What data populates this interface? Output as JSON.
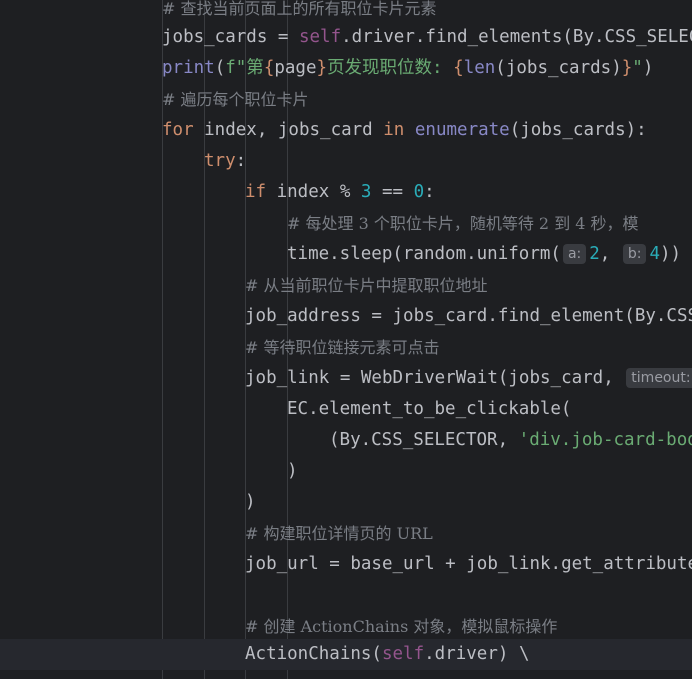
{
  "colors": {
    "background": "#1e1f22",
    "keyword": "#cf8e6d",
    "self": "#94558d",
    "builtin": "#8888c6",
    "number": "#2aacb8",
    "string": "#6aab73",
    "comment": "#7a7e85",
    "text": "#bcbec4",
    "hint_bg": "#393b40"
  },
  "code": {
    "l1_comment": "# 查找当前页面上的所有职位卡片元素",
    "l2_a": "jobs_cards = ",
    "l2_self": "self",
    "l2_b": ".driver.find_elements(By.CSS_SELEC",
    "l3_print": "print",
    "l3_paren": "(",
    "l3_f": "f\"第",
    "l3_brace1": "{",
    "l3_page": "page",
    "l3_brace2": "}",
    "l3_mid": "页发现职位数: ",
    "l3_brace3": "{",
    "l3_len": "len",
    "l3_args": "(jobs_cards)",
    "l3_brace4": "}",
    "l3_end_str": "\"",
    "l3_close": ")",
    "l4_comment": "# 遍历每个职位卡片",
    "l5_for": "for",
    "l5_a": " index, jobs_card ",
    "l5_in": "in",
    "l5_sp": " ",
    "l5_enum": "enumerate",
    "l5_b": "(jobs_cards):",
    "l6_try": "try",
    "l6_colon": ":",
    "l7_if": "if",
    "l7_a": " index % ",
    "l7_n3": "3",
    "l7_b": " == ",
    "l7_n0": "0",
    "l7_c": ":",
    "l8_comment": "# 每处理 3 个职位卡片，随机等待 2 到 4 秒，模",
    "l9_a": "time.sleep(random.uniform(",
    "l9_hint_a": "a:",
    "l9_n2": "2",
    "l9_b": ", ",
    "l9_hint_b": "b:",
    "l9_n4": "4",
    "l9_c": "))",
    "l10_comment": "# 从当前职位卡片中提取职位地址",
    "l11": "job_address = jobs_card.find_element(By.CSS",
    "l12_comment": "# 等待职位链接元素可点击",
    "l13_a": "job_link = WebDriverWait(jobs_card, ",
    "l13_hint": "timeout:",
    "l14": "EC.element_to_be_clickable(",
    "l15_a": "(By.CSS_SELECTOR, ",
    "l15_str": "'div.job-card-bod",
    "l16": ")",
    "l17": ")",
    "l18_comment": "# 构建职位详情页的 URL",
    "l19": "job_url = base_url + job_link.get_attribute",
    "l21_comment": "# 创建 ActionChains 对象，模拟鼠标操作",
    "l22_a": "ActionChains(",
    "l22_self": "self",
    "l22_b": ".driver) \\"
  }
}
